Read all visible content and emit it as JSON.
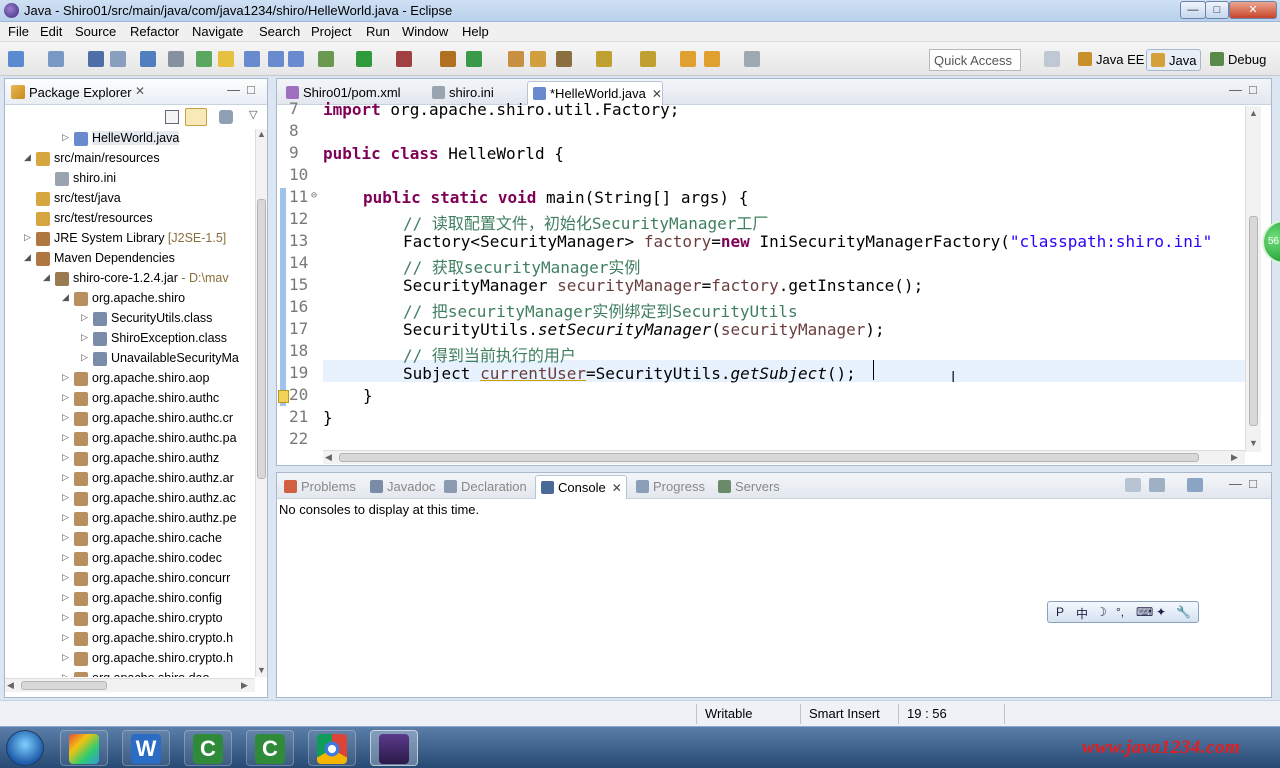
{
  "window": {
    "title": "Java - Shiro01/src/main/java/com/java1234/shiro/HelleWorld.java - Eclipse"
  },
  "menu": [
    "File",
    "Edit",
    "Source",
    "Refactor",
    "Navigate",
    "Search",
    "Project",
    "Run",
    "Window",
    "Help"
  ],
  "toolbar": {
    "quick_access_placeholder": "Quick Access",
    "perspectives": [
      {
        "label": "Java EE",
        "active": false
      },
      {
        "label": "Java",
        "active": true
      },
      {
        "label": "Debug",
        "active": false
      }
    ]
  },
  "explorer": {
    "title": "Package Explorer",
    "items": [
      {
        "label": "HelleWorld.java",
        "icon": "java-file-icon",
        "decoration": "",
        "expander": "collapsed",
        "depth": 3,
        "selected": true
      },
      {
        "label": "src/main/resources",
        "icon": "source-folder-icon",
        "decoration": "",
        "expander": "expanded",
        "depth": 1,
        "selected": false
      },
      {
        "label": "shiro.ini",
        "icon": "ini-file-icon",
        "decoration": "",
        "expander": "none",
        "depth": 2,
        "selected": false
      },
      {
        "label": "src/test/java",
        "icon": "source-folder-icon",
        "decoration": "",
        "expander": "none",
        "depth": 1,
        "selected": false
      },
      {
        "label": "src/test/resources",
        "icon": "source-folder-icon",
        "decoration": "",
        "expander": "none",
        "depth": 1,
        "selected": false
      },
      {
        "label": "JRE System Library ",
        "icon": "library-icon",
        "decoration": "[J2SE-1.5]",
        "expander": "collapsed",
        "depth": 1,
        "selected": false
      },
      {
        "label": "Maven Dependencies",
        "icon": "library-icon",
        "decoration": "",
        "expander": "expanded",
        "depth": 1,
        "selected": false
      },
      {
        "label": "shiro-core-1.2.4.jar",
        "icon": "jar-icon",
        "decoration": " - D:\\mav",
        "expander": "expanded",
        "depth": 2,
        "selected": false
      },
      {
        "label": "org.apache.shiro",
        "icon": "package-icon",
        "decoration": "",
        "expander": "expanded",
        "depth": 3,
        "selected": false
      },
      {
        "label": "SecurityUtils.class",
        "icon": "class-file-icon",
        "decoration": "",
        "expander": "collapsed",
        "depth": 4,
        "selected": false
      },
      {
        "label": "ShiroException.class",
        "icon": "class-file-icon",
        "decoration": "",
        "expander": "collapsed",
        "depth": 4,
        "selected": false
      },
      {
        "label": "UnavailableSecurityMa",
        "icon": "class-file-icon",
        "decoration": "",
        "expander": "collapsed",
        "depth": 4,
        "selected": false
      },
      {
        "label": "org.apache.shiro.aop",
        "icon": "package-icon",
        "decoration": "",
        "expander": "collapsed",
        "depth": 3,
        "selected": false
      },
      {
        "label": "org.apache.shiro.authc",
        "icon": "package-icon",
        "decoration": "",
        "expander": "collapsed",
        "depth": 3,
        "selected": false
      },
      {
        "label": "org.apache.shiro.authc.cr",
        "icon": "package-icon",
        "decoration": "",
        "expander": "collapsed",
        "depth": 3,
        "selected": false
      },
      {
        "label": "org.apache.shiro.authc.pa",
        "icon": "package-icon",
        "decoration": "",
        "expander": "collapsed",
        "depth": 3,
        "selected": false
      },
      {
        "label": "org.apache.shiro.authz",
        "icon": "package-icon",
        "decoration": "",
        "expander": "collapsed",
        "depth": 3,
        "selected": false
      },
      {
        "label": "org.apache.shiro.authz.ar",
        "icon": "package-icon",
        "decoration": "",
        "expander": "collapsed",
        "depth": 3,
        "selected": false
      },
      {
        "label": "org.apache.shiro.authz.ac",
        "icon": "package-icon",
        "decoration": "",
        "expander": "collapsed",
        "depth": 3,
        "selected": false
      },
      {
        "label": "org.apache.shiro.authz.pe",
        "icon": "package-icon",
        "decoration": "",
        "expander": "collapsed",
        "depth": 3,
        "selected": false
      },
      {
        "label": "org.apache.shiro.cache",
        "icon": "package-icon",
        "decoration": "",
        "expander": "collapsed",
        "depth": 3,
        "selected": false
      },
      {
        "label": "org.apache.shiro.codec",
        "icon": "package-icon",
        "decoration": "",
        "expander": "collapsed",
        "depth": 3,
        "selected": false
      },
      {
        "label": "org.apache.shiro.concurr",
        "icon": "package-icon",
        "decoration": "",
        "expander": "collapsed",
        "depth": 3,
        "selected": false
      },
      {
        "label": "org.apache.shiro.config",
        "icon": "package-icon",
        "decoration": "",
        "expander": "collapsed",
        "depth": 3,
        "selected": false
      },
      {
        "label": "org.apache.shiro.crypto",
        "icon": "package-icon",
        "decoration": "",
        "expander": "collapsed",
        "depth": 3,
        "selected": false
      },
      {
        "label": "org.apache.shiro.crypto.h",
        "icon": "package-icon",
        "decoration": "",
        "expander": "collapsed",
        "depth": 3,
        "selected": false
      },
      {
        "label": "org.apache.shiro.crypto.h",
        "icon": "package-icon",
        "decoration": "",
        "expander": "collapsed",
        "depth": 3,
        "selected": false
      },
      {
        "label": "org.apache.shiro.dao",
        "icon": "package-icon",
        "decoration": "",
        "expander": "collapsed",
        "depth": 3,
        "selected": false
      }
    ]
  },
  "editor": {
    "tabs": [
      {
        "label": "Shiro01/pom.xml",
        "icon": "maven-xml-icon",
        "active": false,
        "closable": false
      },
      {
        "label": "shiro.ini",
        "icon": "ini-file-icon",
        "active": false,
        "closable": false
      },
      {
        "label": "*HelleWorld.java",
        "icon": "java-file-icon",
        "active": true,
        "closable": true
      }
    ],
    "current_line": "19",
    "lines": [
      {
        "num": "7",
        "indent": 0,
        "tokens": [
          {
            "t": "import",
            "c": "kw"
          },
          {
            "t": " org.apache.shiro.util.Factory;",
            "c": ""
          }
        ]
      },
      {
        "num": "8",
        "indent": 0,
        "tokens": []
      },
      {
        "num": "9",
        "indent": 0,
        "tokens": [
          {
            "t": "public",
            "c": "kw"
          },
          {
            "t": " ",
            "c": ""
          },
          {
            "t": "class",
            "c": "kw"
          },
          {
            "t": " HelleWorld {",
            "c": ""
          }
        ]
      },
      {
        "num": "10",
        "indent": 0,
        "tokens": []
      },
      {
        "num": "11",
        "indent": 1,
        "tokens": [
          {
            "t": "public",
            "c": "kw"
          },
          {
            "t": " ",
            "c": ""
          },
          {
            "t": "static",
            "c": "kw"
          },
          {
            "t": " ",
            "c": ""
          },
          {
            "t": "void",
            "c": "kw"
          },
          {
            "t": " main(String[] args) {",
            "c": ""
          }
        ]
      },
      {
        "num": "12",
        "indent": 2,
        "tokens": [
          {
            "t": "// 读取配置文件，初始化SecurityManager工厂",
            "c": "cm"
          }
        ]
      },
      {
        "num": "13",
        "indent": 2,
        "tokens": [
          {
            "t": "Factory<SecurityManager> ",
            "c": ""
          },
          {
            "t": "factory",
            "c": "fd"
          },
          {
            "t": "=",
            "c": ""
          },
          {
            "t": "new",
            "c": "kw"
          },
          {
            "t": " IniSecurityManagerFactory(",
            "c": ""
          },
          {
            "t": "\"classpath:shiro.ini\"",
            "c": "st"
          }
        ]
      },
      {
        "num": "14",
        "indent": 2,
        "tokens": [
          {
            "t": "// 获取securityManager实例",
            "c": "cm"
          }
        ]
      },
      {
        "num": "15",
        "indent": 2,
        "tokens": [
          {
            "t": "SecurityManager ",
            "c": ""
          },
          {
            "t": "securityManager",
            "c": "fd"
          },
          {
            "t": "=",
            "c": ""
          },
          {
            "t": "factory",
            "c": "fd"
          },
          {
            "t": ".getInstance();",
            "c": ""
          }
        ]
      },
      {
        "num": "16",
        "indent": 2,
        "tokens": [
          {
            "t": "// 把securityManager实例绑定到SecurityUtils",
            "c": "cm"
          }
        ]
      },
      {
        "num": "17",
        "indent": 2,
        "tokens": [
          {
            "t": "SecurityUtils.",
            "c": ""
          },
          {
            "t": "setSecurityManager",
            "c": "it"
          },
          {
            "t": "(",
            "c": ""
          },
          {
            "t": "securityManager",
            "c": "fd"
          },
          {
            "t": ");",
            "c": ""
          }
        ]
      },
      {
        "num": "18",
        "indent": 2,
        "tokens": [
          {
            "t": "// 得到当前执行的用户",
            "c": "cm"
          }
        ]
      },
      {
        "num": "19",
        "indent": 2,
        "tokens": [
          {
            "t": "Subject ",
            "c": ""
          },
          {
            "t": "currentUser",
            "c": "ul"
          },
          {
            "t": "=SecurityUtils.",
            "c": ""
          },
          {
            "t": "getSubject",
            "c": "it"
          },
          {
            "t": "();",
            "c": ""
          }
        ]
      },
      {
        "num": "20",
        "indent": 1,
        "tokens": [
          {
            "t": "}",
            "c": ""
          }
        ]
      },
      {
        "num": "21",
        "indent": 0,
        "tokens": [
          {
            "t": "}",
            "c": ""
          }
        ]
      },
      {
        "num": "22",
        "indent": 0,
        "tokens": []
      }
    ]
  },
  "console": {
    "tabs": [
      {
        "label": "Problems",
        "icon": "problems-icon",
        "active": false
      },
      {
        "label": "Javadoc",
        "icon": "javadoc-icon",
        "active": false
      },
      {
        "label": "Declaration",
        "icon": "declaration-icon",
        "active": false
      },
      {
        "label": "Console",
        "icon": "console-icon",
        "active": true
      },
      {
        "label": "Progress",
        "icon": "progress-icon",
        "active": false
      },
      {
        "label": "Servers",
        "icon": "servers-icon",
        "active": false
      }
    ],
    "message": "No consoles to display at this time.",
    "ime_toolbar": [
      "P",
      "中",
      "☽",
      "°,",
      "⌨",
      "✦",
      "🔧"
    ]
  },
  "status": {
    "writable": "Writable",
    "insert_mode": "Smart Insert",
    "position": "19 : 56"
  },
  "taskbar": {
    "apps": [
      {
        "name": "start-orb",
        "label": ""
      },
      {
        "name": "ime-app-icon",
        "label": ""
      },
      {
        "name": "wps-writer-icon",
        "label": "W"
      },
      {
        "name": "camtasia-icon",
        "label": "C"
      },
      {
        "name": "camtasia-recorder-icon",
        "label": "C"
      },
      {
        "name": "chrome-icon",
        "label": ""
      },
      {
        "name": "eclipse-javaee-icon",
        "label": ""
      }
    ],
    "watermark": "www.java1234.com"
  },
  "badge": {
    "text": "56"
  },
  "colors": {
    "keyword": "#7f0055",
    "comment": "#3f7f5f",
    "string": "#2a00ff",
    "field": "#6a3e3e",
    "current_line_bg": "#e8f2fe",
    "watermark": "#e81c1c"
  }
}
